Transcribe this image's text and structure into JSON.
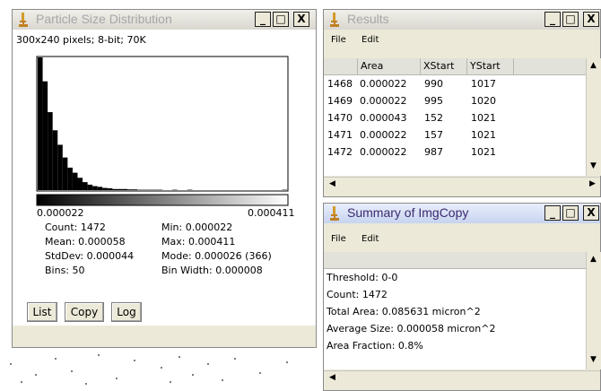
{
  "histogram_window": {
    "title": "Particle Size Distribution",
    "info": "300x240 pixels; 8-bit; 70K",
    "axis_min": "0.000022",
    "axis_max": "0.000411",
    "stats": {
      "count": "Count: 1472",
      "mean": "Mean: 0.000058",
      "stddev": "StdDev: 0.000044",
      "bins": "Bins: 50",
      "min": "Min: 0.000022",
      "max": "Max: 0.000411",
      "mode": "Mode: 0.000026 (366)",
      "bin_width": "Bin Width: 0.000008"
    },
    "buttons": {
      "list": "List",
      "copy": "Copy",
      "log": "Log"
    },
    "window_buttons": {
      "minimize": "_",
      "maximize": "□",
      "close": "X"
    }
  },
  "chart_data": {
    "type": "bar",
    "x_range": [
      2.2e-05,
      0.000411
    ],
    "values": [
      366,
      300,
      215,
      165,
      125,
      90,
      62,
      48,
      34,
      22,
      15,
      11,
      9,
      6,
      5,
      3,
      3,
      3,
      2,
      2,
      1,
      1,
      1,
      1,
      1,
      0,
      0,
      1,
      0,
      0,
      1,
      0,
      0,
      0,
      0,
      0,
      0,
      0,
      0,
      0,
      0,
      0,
      0,
      0,
      0,
      0,
      0,
      0,
      0,
      1
    ]
  },
  "results_window": {
    "title": "Results",
    "menu": [
      "File",
      "Edit"
    ],
    "columns": [
      "",
      "Area",
      "XStart",
      "YStart"
    ],
    "rows": [
      [
        "1468",
        "0.000022",
        "990",
        "1017"
      ],
      [
        "1469",
        "0.000022",
        "995",
        "1020"
      ],
      [
        "1470",
        "0.000043",
        "152",
        "1021"
      ],
      [
        "1471",
        "0.000022",
        "157",
        "1021"
      ],
      [
        "1472",
        "0.000022",
        "987",
        "1021"
      ]
    ],
    "window_buttons": {
      "minimize": "_",
      "maximize": "□",
      "close": "X"
    }
  },
  "summary_window": {
    "title": "Summary of ImgCopy",
    "menu": [
      "File",
      "Edit"
    ],
    "lines": [
      "Threshold: 0-0",
      "Count: 1472",
      "Total Area: 0.085631 micron^2",
      "Average Size: 0.000058 micron^2",
      "Area Fraction: 0.8%"
    ],
    "window_buttons": {
      "minimize": "_",
      "maximize": "□",
      "close": "X"
    }
  },
  "colors": {
    "title_inactive_text": "#a5a6a8",
    "title_active_text": "#3a2a6f",
    "window_bg": "#ece9d8"
  }
}
